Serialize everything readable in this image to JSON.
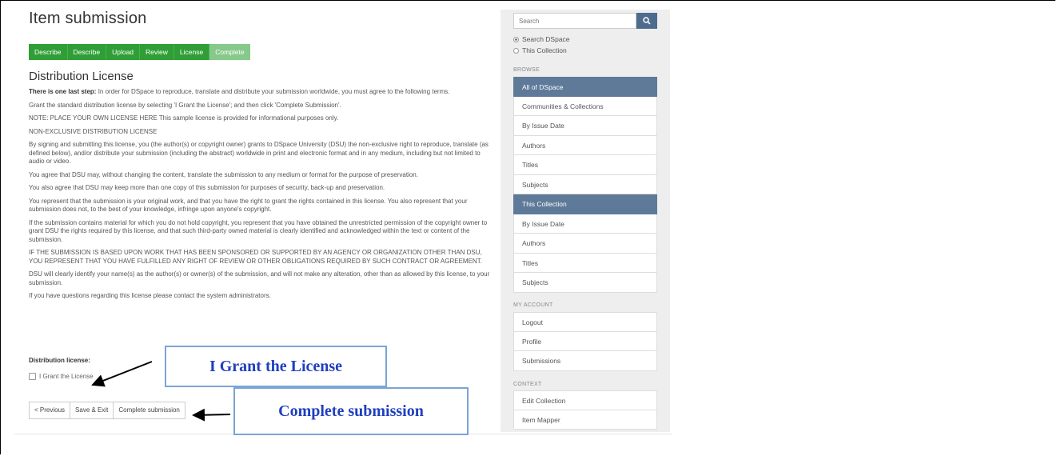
{
  "page": {
    "title": "Item submission"
  },
  "steps": [
    {
      "label": "Describe"
    },
    {
      "label": "Describe"
    },
    {
      "label": "Upload"
    },
    {
      "label": "Review"
    },
    {
      "label": "License"
    },
    {
      "label": "Complete"
    }
  ],
  "license": {
    "heading": "Distribution License",
    "intro_bold": "There is one last step:",
    "intro_rest": " In order for DSpace to reproduce, translate and distribute your submission worldwide, you must agree to the following terms.",
    "paragraphs": [
      "Grant the standard distribution license by selecting 'I Grant the License'; and then click 'Complete Submission'.",
      "NOTE: PLACE YOUR OWN LICENSE HERE This sample license is provided for informational purposes only.",
      "NON-EXCLUSIVE DISTRIBUTION LICENSE",
      "By signing and submitting this license, you (the author(s) or copyright owner) grants to DSpace University (DSU) the non-exclusive right to reproduce, translate (as defined below), and/or distribute your submission (including the abstract) worldwide in print and electronic format and in any medium, including but not limited to audio or video.",
      "You agree that DSU may, without changing the content, translate the submission to any medium or format for the purpose of preservation.",
      "You also agree that DSU may keep more than one copy of this submission for purposes of security, back-up and preservation.",
      "You represent that the submission is your original work, and that you have the right to grant the rights contained in this license. You also represent that your submission does not, to the best of your knowledge, infringe upon anyone's copyright.",
      "If the submission contains material for which you do not hold copyright, you represent that you have obtained the unrestricted permission of the copyright owner to grant DSU the rights required by this license, and that such third-party owned material is clearly identified and acknowledged within the text or content of the submission.",
      "IF THE SUBMISSION IS BASED UPON WORK THAT HAS BEEN SPONSORED OR SUPPORTED BY AN AGENCY OR ORGANIZATION OTHER THAN DSU, YOU REPRESENT THAT YOU HAVE FULFILLED ANY RIGHT OF REVIEW OR OTHER OBLIGATIONS REQUIRED BY SUCH CONTRACT OR AGREEMENT.",
      "DSU will clearly identify your name(s) as the author(s) or owner(s) of the submission, and will not make any alteration, other than as allowed by this license, to your submission.",
      "If you have questions regarding this license please contact the system administrators."
    ],
    "dist_label": "Distribution license:",
    "grant_label": "I Grant the License"
  },
  "buttons": {
    "previous": "< Previous",
    "save_exit": "Save & Exit",
    "complete": "Complete submission"
  },
  "callouts": {
    "grant": "I Grant the License",
    "complete": "Complete submission"
  },
  "sidebar": {
    "search_placeholder": "Search",
    "scope": [
      {
        "label": "Search DSpace",
        "selected": true
      },
      {
        "label": "This Collection",
        "selected": false
      }
    ],
    "browse_head": "BROWSE",
    "browse_all": {
      "header": "All of DSpace",
      "items": [
        "Communities & Collections",
        "By Issue Date",
        "Authors",
        "Titles",
        "Subjects"
      ]
    },
    "browse_collection": {
      "header": "This Collection",
      "items": [
        "By Issue Date",
        "Authors",
        "Titles",
        "Subjects"
      ]
    },
    "account_head": "MY ACCOUNT",
    "account_items": [
      "Logout",
      "Profile",
      "Submissions"
    ],
    "context_head": "CONTEXT",
    "context_items": [
      "Edit Collection",
      "Item Mapper"
    ]
  },
  "colors": {
    "step_green": "#2f9e36",
    "step_active": "#86c98a",
    "sidebar_header": "#5e7a98",
    "callout_text": "#1f3fbf",
    "callout_border": "#7aa5d6"
  }
}
